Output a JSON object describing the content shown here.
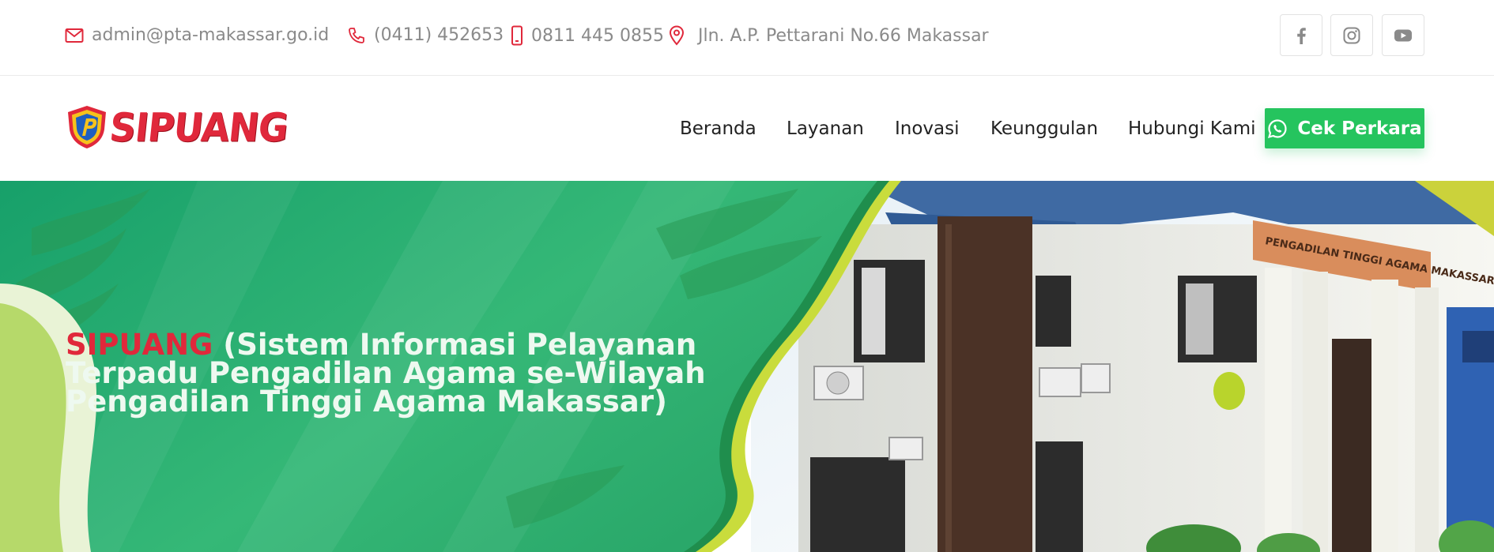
{
  "topbar": {
    "email": "admin@pta-makassar.go.id",
    "phone": "(0411) 452653",
    "mobile": "0811 445 0855",
    "address": "Jln. A.P. Pettarani No.66 Makassar",
    "social": [
      {
        "icon": "facebook-icon"
      },
      {
        "icon": "instagram-icon"
      },
      {
        "icon": "youtube-icon"
      }
    ]
  },
  "logo": {
    "text": "SIPUANG"
  },
  "nav": {
    "items": [
      "Beranda",
      "Layanan",
      "Inovasi",
      "Keunggulan",
      "Hubungi Kami"
    ],
    "cta": "Cek Perkara"
  },
  "hero": {
    "brand": "SIPUANG",
    "title": " (Sistem Informasi Pelayanan Terpadu Pengadilan Agama se-Wilayah Pengadilan Tinggi Agama Makassar)",
    "signboard": "PENGADILAN TINGGI AGAMA MAKASSAR"
  },
  "colors": {
    "accent_red": "#e0283b",
    "cta_green": "#25c45e",
    "hero_green": "#22a86a",
    "lime": "#c9dc3c"
  }
}
